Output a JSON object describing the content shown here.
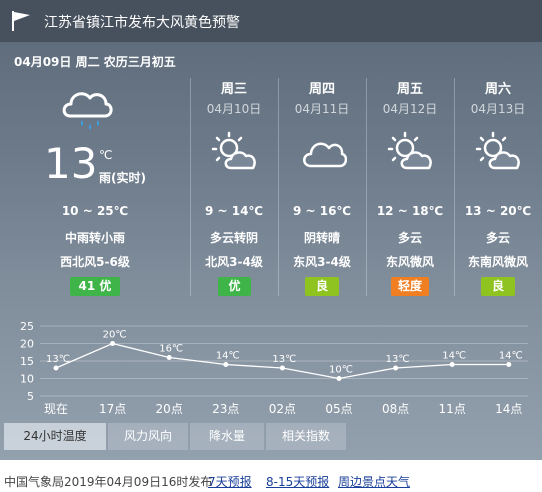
{
  "alert": {
    "text": "江苏省镇江市发布大风黄色预警",
    "icon": "warning-flag-icon"
  },
  "header": {
    "date_line": "04月09日 周二 农历三月初五"
  },
  "today": {
    "icon": "cloud-rain-icon",
    "temp": "13",
    "unit": "℃",
    "desc": "雨(实时)",
    "temp_range": "10 ~ 25℃",
    "weather": "中雨转小雨",
    "wind": "西北风5-6级",
    "aqi": "41 优",
    "aqi_color": "#3fb449"
  },
  "forecast": [
    {
      "weekday": "周三",
      "date": "04月10日",
      "icon": "partly-cloudy-icon",
      "temp_range": "9 ~ 14℃",
      "weather": "多云转阴",
      "wind": "北风3-4级",
      "aqi": "优",
      "aqi_color": "#3fb449"
    },
    {
      "weekday": "周四",
      "date": "04月11日",
      "icon": "cloud-icon",
      "temp_range": "9 ~ 16℃",
      "weather": "阴转晴",
      "wind": "东风3-4级",
      "aqi": "良",
      "aqi_color": "#8fc320"
    },
    {
      "weekday": "周五",
      "date": "04月12日",
      "icon": "partly-cloudy-icon",
      "temp_range": "12 ~ 18℃",
      "weather": "多云",
      "wind": "东风微风",
      "aqi": "轻度",
      "aqi_color": "#f07f24"
    },
    {
      "weekday": "周六",
      "date": "04月13日",
      "icon": "partly-cloudy-icon",
      "temp_range": "13 ~ 20℃",
      "weather": "多云",
      "wind": "东南风微风",
      "aqi": "良",
      "aqi_color": "#8fc320"
    }
  ],
  "chart_data": {
    "type": "line",
    "categories": [
      "现在",
      "17点",
      "20点",
      "23点",
      "02点",
      "05点",
      "08点",
      "11点",
      "14点"
    ],
    "values": [
      13,
      20,
      16,
      14,
      13,
      10,
      13,
      14,
      14
    ],
    "labels": [
      "13℃",
      "20℃",
      "16℃",
      "14℃",
      "13℃",
      "10℃",
      "13℃",
      "14℃",
      "14℃"
    ],
    "yticks": [
      "25",
      "20",
      "15",
      "10",
      "5"
    ],
    "ylim": [
      5,
      25
    ],
    "grid": true
  },
  "tabs": [
    {
      "label": "24小时温度",
      "active": true
    },
    {
      "label": "风力风向",
      "active": false
    },
    {
      "label": "降水量",
      "active": false
    },
    {
      "label": "相关指数",
      "active": false
    }
  ],
  "footer": {
    "publish": "中国气象局2019年04月09日16时发布",
    "links": [
      "7天预报",
      "8-15天预报",
      "周边景点天气"
    ]
  }
}
